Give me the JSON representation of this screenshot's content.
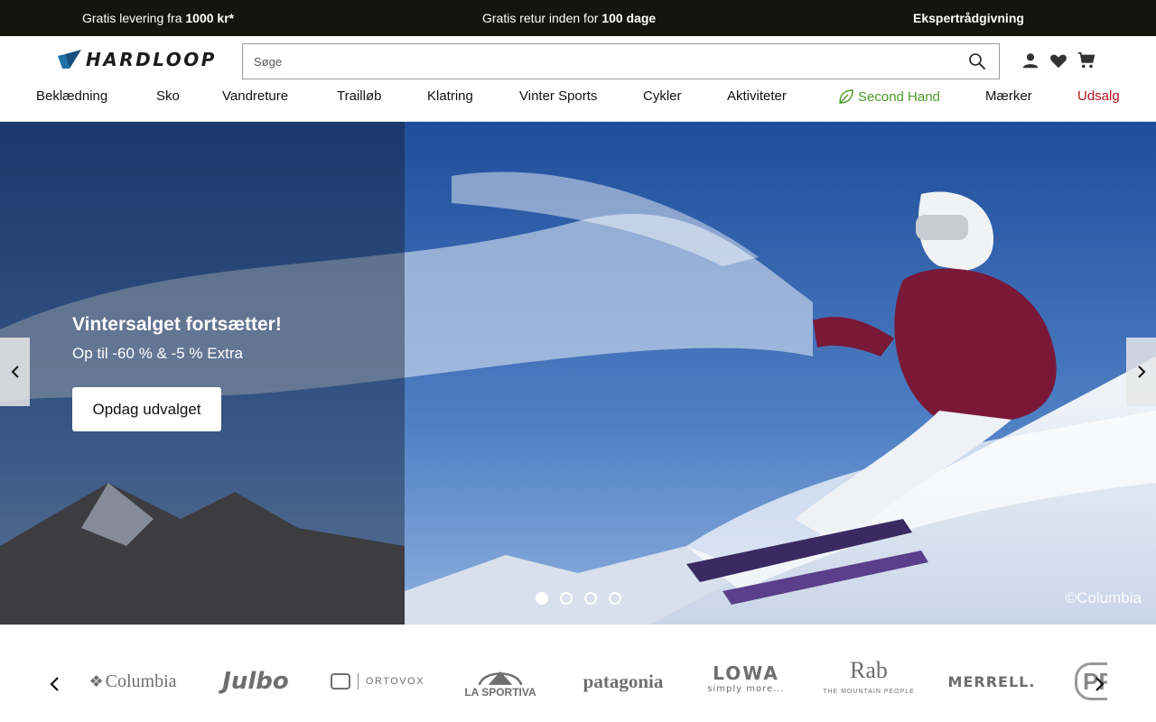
{
  "topbar": {
    "promo1_text": "Gratis levering fra ",
    "promo1_bold": "1000 kr*",
    "promo2_text": "Gratis retur inden for ",
    "promo2_bold": "100 dage",
    "promo3_bold": "Ekspertrådgivning"
  },
  "header": {
    "logo_text": "HARDLOOP",
    "search_placeholder": "Søge"
  },
  "nav": {
    "items": [
      "Beklædning",
      "Sko",
      "Vandreture",
      "Trailløb",
      "Klatring",
      "Vinter Sports",
      "Cykler",
      "Aktiviteter",
      "Second Hand",
      "Mærker",
      "Udsalg"
    ]
  },
  "hero": {
    "title": "Vintersalget fortsætter!",
    "subtitle": "Op til -60 % & -5 % Extra",
    "cta_label": "Opdag udvalget",
    "credit": "©Columbia",
    "slide_count": 4,
    "active_slide": 1
  },
  "brands": {
    "columbia": "Columbia",
    "julbo": "Julbo",
    "ortovox": "ORTOVOX",
    "lasportiva": "LA SPORTIVA",
    "patagonia": "patagonia",
    "lowa": "LOWA",
    "lowa_tagline": "simply more...",
    "rab": "Rab",
    "rab_tagline": "THE MOUNTAIN PEOPLE",
    "merrell": "MERRELL.",
    "partial": "PR"
  },
  "colors": {
    "topbar_bg": "#141510",
    "second_hand": "#4b9b2a",
    "sale": "#b3121b",
    "logo_blue": "#1f6fa8"
  }
}
